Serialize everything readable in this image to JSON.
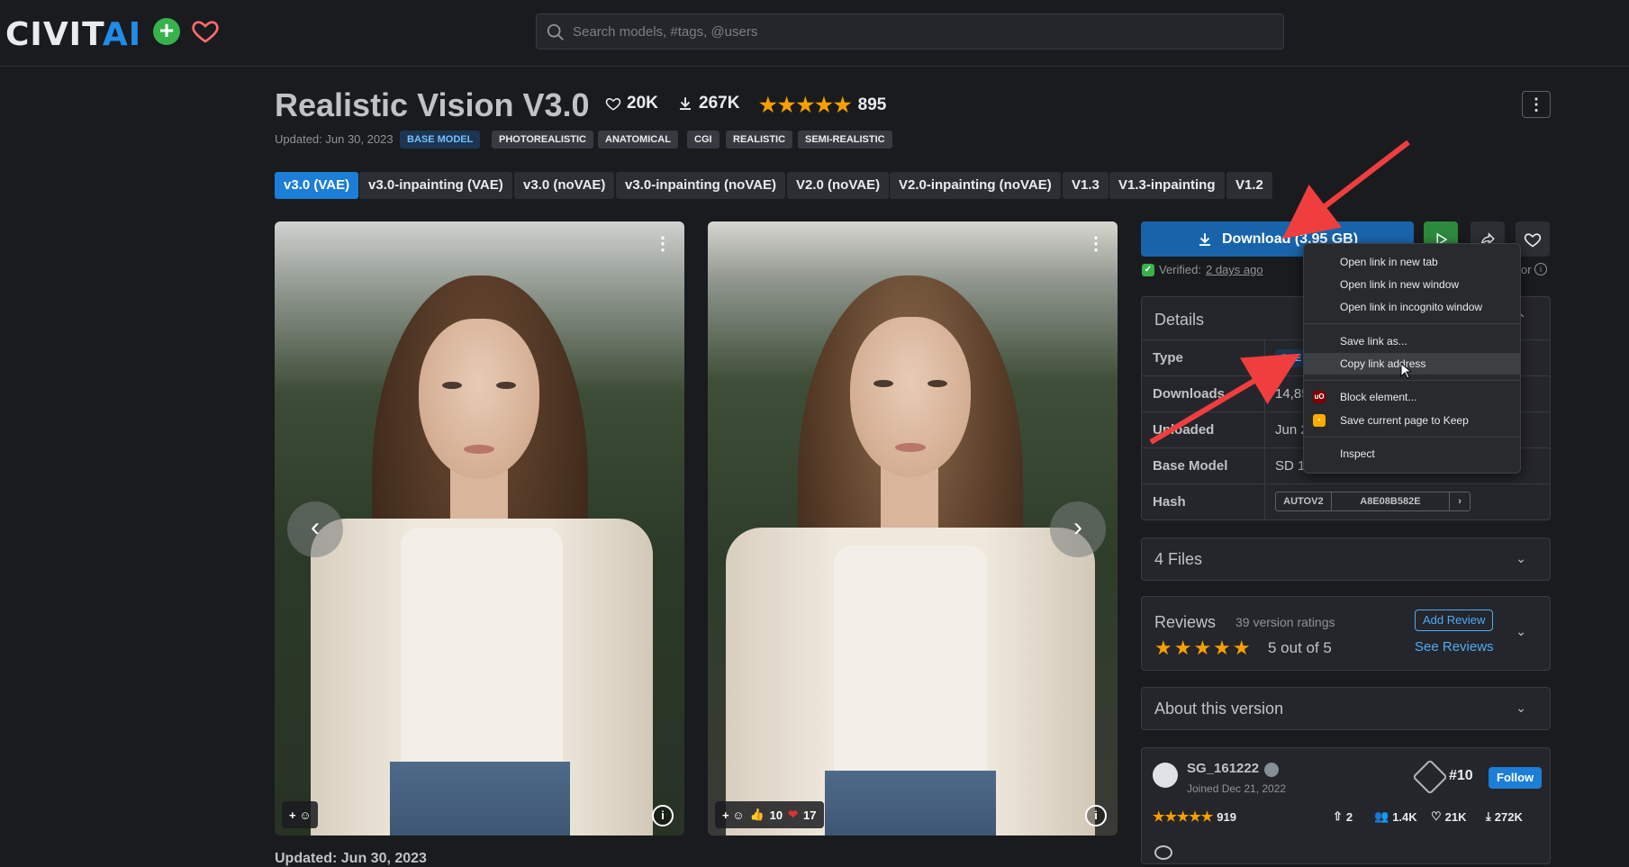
{
  "header": {
    "logo_left": "CIVIT",
    "logo_right": "AI",
    "search_placeholder": "Search models, #tags, @users"
  },
  "model": {
    "title": "Realistic Vision V3.0",
    "likes": "20K",
    "downloads": "267K",
    "rating_count": "895",
    "updated": "Updated: Jun 30, 2023",
    "tags": [
      "BASE MODEL",
      "PHOTOREALISTIC",
      "ANATOMICAL",
      "CGI",
      "REALISTIC",
      "SEMI-REALISTIC"
    ]
  },
  "versions": [
    "v3.0 (VAE)",
    "v3.0-inpainting (VAE)",
    "v3.0 (noVAE)",
    "v3.0-inpainting (noVAE)",
    "V2.0 (noVAE)",
    "V2.0-inpainting (noVAE)",
    "V1.3",
    "V1.3-inpainting",
    "V1.2"
  ],
  "gallery": {
    "card2_likes": "10",
    "card2_hearts": "17"
  },
  "download": {
    "label": "Download (3.95 GB)",
    "verified_label": "Verified:",
    "verified_when": "2 days ago",
    "or_text": "or"
  },
  "details": {
    "title": "Details",
    "rows": [
      {
        "label": "Type",
        "value": "CHE"
      },
      {
        "label": "Downloads",
        "value": "14,85"
      },
      {
        "label": "Uploaded",
        "value": "Jun 2"
      },
      {
        "label": "Base Model",
        "value": "SD 1."
      },
      {
        "label": "Hash",
        "value": ""
      }
    ],
    "hash_type": "AUTOV2",
    "hash_value": "A8E08B582E"
  },
  "files": {
    "title": "4 Files"
  },
  "reviews": {
    "title": "Reviews",
    "count": "39 version ratings",
    "score": "5 out of 5",
    "add_label": "Add Review",
    "see_label": "See Reviews"
  },
  "about": {
    "title": "About this version"
  },
  "creator": {
    "name": "SG_161222",
    "joined": "Joined Dec 21, 2022",
    "rank": "#10",
    "follow_label": "Follow",
    "ratings": "919",
    "uploads": "2",
    "followers": "1.4K",
    "likes": "21K",
    "downloads": "272K"
  },
  "context_menu": {
    "items": [
      "Open link in new tab",
      "Open link in new window",
      "Open link in incognito window",
      "Save link as...",
      "Copy link address",
      "Block element...",
      "Save current page to Keep",
      "Inspect"
    ]
  },
  "footer_partial": "Updated: Jun 30, 2023",
  "colors": {
    "accent": "#1c7ed6",
    "star": "#f59f00",
    "annotation_arrow": "#f03e3e"
  }
}
